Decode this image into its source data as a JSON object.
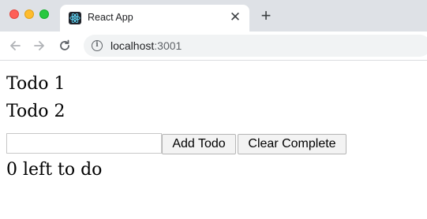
{
  "browser": {
    "tab": {
      "title": "React App",
      "favicon": "react-logo-icon",
      "close_glyph": "✕"
    },
    "new_tab_glyph": "+",
    "nav": {
      "back_icon": "back-arrow-icon",
      "forward_icon": "forward-arrow-icon",
      "reload_icon": "reload-icon"
    },
    "address_bar": {
      "security_icon": "info-icon",
      "host": "localhost",
      "port": ":3001"
    },
    "colors": {
      "tabstrip": "#dee1e6",
      "omnibox": "#f1f3f4",
      "close": "#fe5f57",
      "minimize": "#febc2e",
      "maximize": "#28c840",
      "react_cyan": "#61dafb"
    }
  },
  "app": {
    "todos": [
      {
        "text": "Todo 1"
      },
      {
        "text": "Todo 2"
      }
    ],
    "new_todo_input": {
      "value": "",
      "placeholder": ""
    },
    "add_button_label": "Add Todo",
    "clear_button_label": "Clear Complete",
    "remaining_text": "0 left to do"
  }
}
